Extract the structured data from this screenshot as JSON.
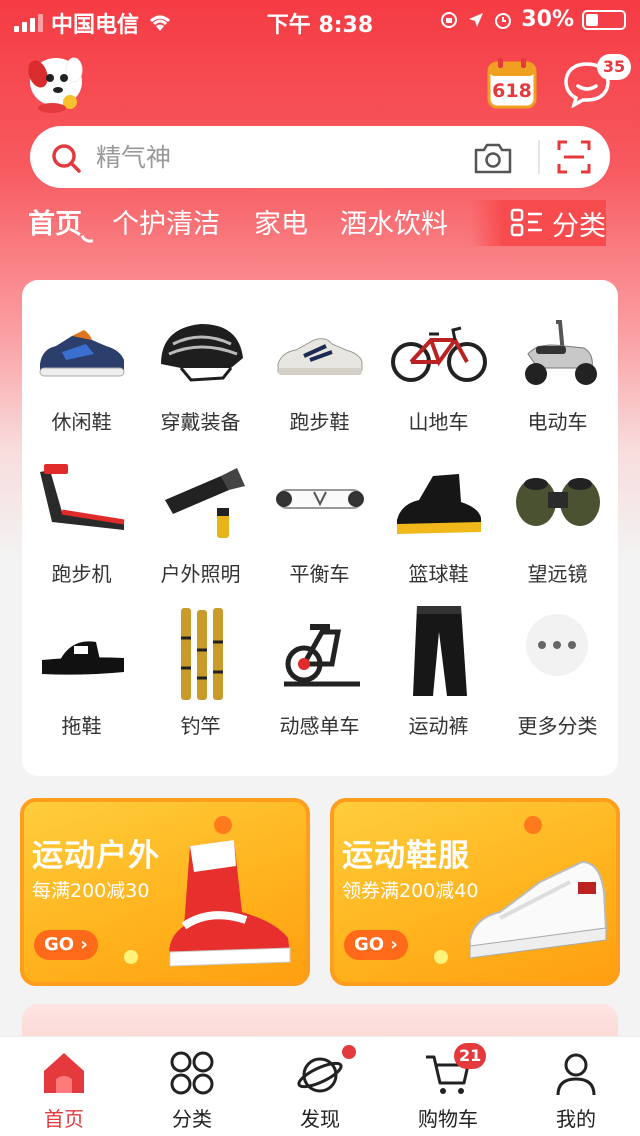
{
  "status_bar": {
    "carrier": "中国电信",
    "time": "下午 8:38",
    "battery": "30%",
    "battery_level": 0.3,
    "icons": [
      "signal-icon",
      "wifi-icon",
      "orientation-lock-icon",
      "location-icon",
      "alarm-icon",
      "battery-icon"
    ]
  },
  "header": {
    "calendar_badge": "618",
    "messages_count": "35"
  },
  "search": {
    "placeholder": "精气神"
  },
  "tabs": [
    {
      "label": "首页"
    },
    {
      "label": "个护清洁"
    },
    {
      "label": "家电"
    },
    {
      "label": "酒水饮料"
    }
  ],
  "category_button": {
    "label": "分类"
  },
  "categories": [
    {
      "label": "休闲鞋",
      "icon": "casual-shoe-icon"
    },
    {
      "label": "穿戴装备",
      "icon": "helmet-icon"
    },
    {
      "label": "跑步鞋",
      "icon": "running-shoe-icon"
    },
    {
      "label": "山地车",
      "icon": "mountain-bike-icon"
    },
    {
      "label": "电动车",
      "icon": "e-scooter-icon"
    },
    {
      "label": "跑步机",
      "icon": "treadmill-icon"
    },
    {
      "label": "户外照明",
      "icon": "flashlight-icon"
    },
    {
      "label": "平衡车",
      "icon": "hoverboard-icon"
    },
    {
      "label": "篮球鞋",
      "icon": "basketball-shoe-icon"
    },
    {
      "label": "望远镜",
      "icon": "binoculars-icon"
    },
    {
      "label": "拖鞋",
      "icon": "slipper-icon"
    },
    {
      "label": "钓竿",
      "icon": "fishing-rod-icon"
    },
    {
      "label": "动感单车",
      "icon": "spin-bike-icon"
    },
    {
      "label": "运动裤",
      "icon": "sweatpants-icon"
    },
    {
      "label": "更多分类",
      "icon": "more-icon"
    }
  ],
  "promos": [
    {
      "title": "运动户外",
      "subtitle": "每满200减30",
      "cta": "GO ›"
    },
    {
      "title": "运动鞋服",
      "subtitle": "领券满200减40",
      "cta": "GO ›"
    }
  ],
  "nav": [
    {
      "label": "首页",
      "icon": "home-icon"
    },
    {
      "label": "分类",
      "icon": "category-icon"
    },
    {
      "label": "发现",
      "icon": "discover-icon"
    },
    {
      "label": "购物车",
      "icon": "cart-icon"
    },
    {
      "label": "我的",
      "icon": "profile-icon"
    }
  ],
  "cart_count": "21",
  "colors": {
    "brand": "#e43a3d",
    "promo": "#ffb21c"
  }
}
